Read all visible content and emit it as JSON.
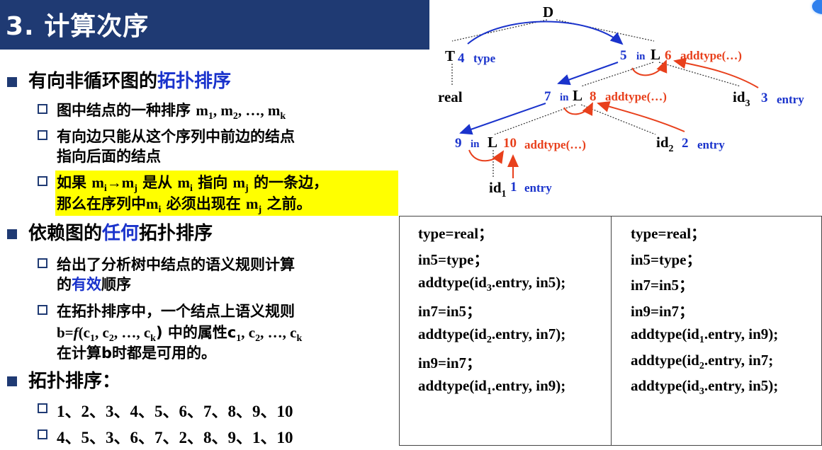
{
  "title": "3. 计算次序",
  "bullets": {
    "b1": {
      "pre": "有向非循环图的",
      "highlight": "拓扑排序"
    },
    "b1_1": {
      "text": "图中结点的一种排序 ",
      "m1": "m",
      "s1": "1",
      "sep1": ", ",
      "m2": "m",
      "s2": "2",
      "ell": ", …, ",
      "mk": "m",
      "sk": "k"
    },
    "b1_2": {
      "line1": "有向边只能从这个序列中前边的结点",
      "line2": "指向后面的结点"
    },
    "b1_3": {
      "l1a": "如果 ",
      "mi": "m",
      "i": "i",
      "arrow": "→",
      "mj": "m",
      "j": "j",
      "l1b": " 是从 ",
      "mi2": "m",
      "i2": "i",
      "l1c": " 指向 ",
      "mj2": "m",
      "j2": "j",
      "l1d": " 的一条边，",
      "l2a": "那么在序列中",
      "mi3": "m",
      "i3": "i",
      "l2b": " 必须出现在 ",
      "mj3": "m",
      "j3": "j",
      "l2c": " 之前。"
    },
    "b2": {
      "pre": "依赖图的",
      "highlight": "任何",
      "post": "拓扑排序"
    },
    "b2_1": {
      "line1": "给出了分析树中结点的语义规则计算",
      "line2a": "的",
      "line2b": "有效",
      "line2c": "顺序"
    },
    "b2_2": {
      "line1": "在拓扑排序中，一个结点上语义规则",
      "l2a": "b=",
      "f": "f",
      "l2b": "(c",
      "s1": "1",
      "l2c": ", c",
      "s2": "2",
      "l2d": ", …, c",
      "sk": "k",
      "l2e": ") 中的属性c",
      "s3": "1",
      "l2f": ", c",
      "s4": "2",
      "l2g": ", …, c",
      "s5": "k",
      "line3": "在计算b时都是可用的。"
    },
    "b3": {
      "text": "拓扑排序："
    },
    "b3_1": {
      "text": "1、2、3、4、5、6、7、8、9、10"
    },
    "b3_2": {
      "text": "4、5、3、6、7、2、8、9、1、10"
    }
  },
  "tree": {
    "D": "D",
    "T": "T",
    "n4": "4",
    "type": "type",
    "n5": "5",
    "in5": "in",
    "L1": "L",
    "n6": "6",
    "add6": "addtype(…)",
    "real": "real",
    "n7": "7",
    "in7": "in",
    "L2": "L",
    "n8": "8",
    "add8": "addtype(…)",
    "id3": "id",
    "id3s": "3",
    "n3": "3",
    "entry3": "entry",
    "n9": "9",
    "in9": "in",
    "L3": "L",
    "n10": "10",
    "add10": "addtype(…)",
    "id2": "id",
    "id2s": "2",
    "n2": "2",
    "entry2": "entry",
    "id1": "id",
    "id1s": "1",
    "n1": "1",
    "entry1": "entry"
  },
  "left_code": [
    {
      "a": "type=real；"
    },
    {
      "a": "in5=type；"
    },
    {
      "a": "addtype(id",
      "s": "3",
      "b": ".entry, in5);"
    },
    {
      "a": "in7=in5；"
    },
    {
      "a": "addtype(id",
      "s": "2",
      "b": ".entry, in7);"
    },
    {
      "a": "in9=in7；"
    },
    {
      "a": "addtype(id",
      "s": "1",
      "b": ".entry, in9);"
    }
  ],
  "right_code": [
    {
      "a": "type=real；"
    },
    {
      "a": "in5=type；"
    },
    {
      "a": "in7=in5；"
    },
    {
      "a": "in9=in7；"
    },
    {
      "a": "addtype(id",
      "s": "1",
      "b": ".entry, in9);"
    },
    {
      "a": "addtype(id",
      "s": "2",
      "b": ".entry, in7;"
    },
    {
      "a": "addtype(id",
      "s": "3",
      "b": ".entry, in5);"
    }
  ],
  "colors": {
    "blue": "#1a33cc",
    "red": "#e8401c",
    "navy": "#1f3a73",
    "highlight": "#ffff00"
  }
}
